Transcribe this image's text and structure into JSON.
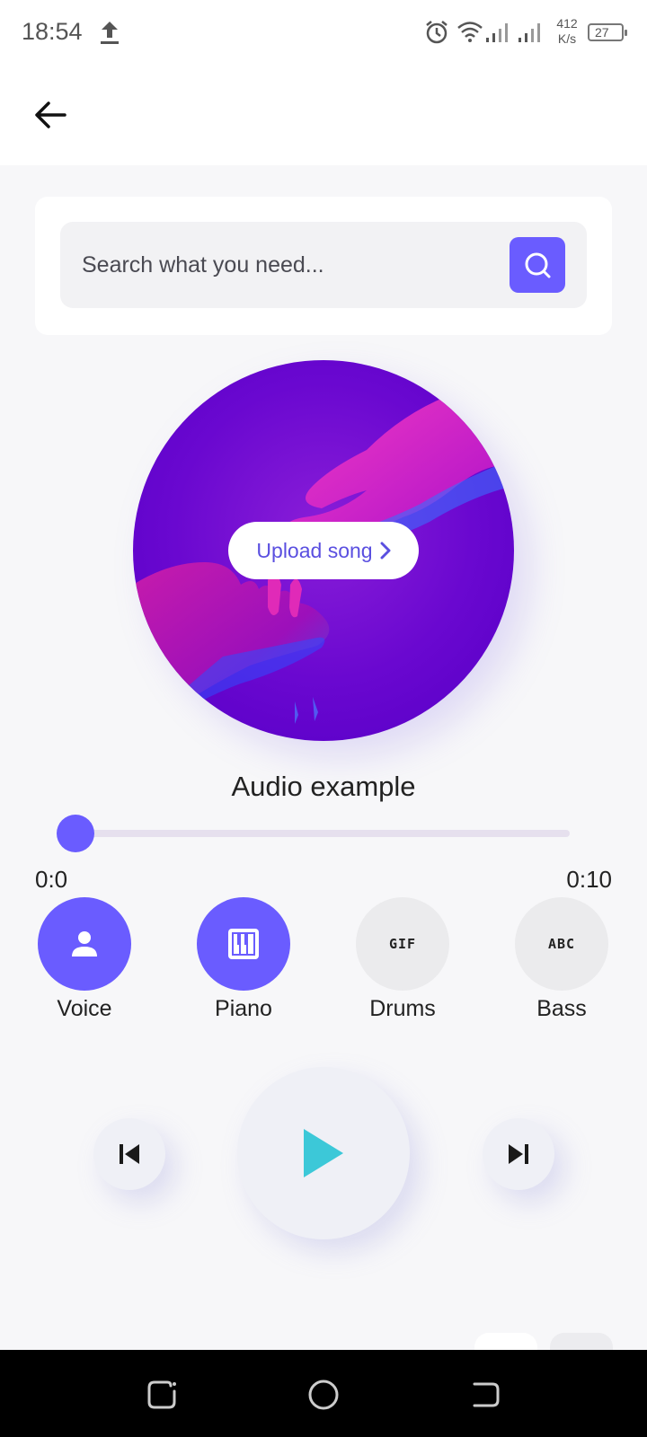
{
  "status_bar": {
    "time": "18:54",
    "net_speed_value": "412",
    "net_speed_unit": "K/s",
    "battery": "27",
    "icons": [
      "upload-icon",
      "alarm-icon",
      "wifi-icon",
      "signal-icon",
      "signal-icon",
      "battery-icon"
    ]
  },
  "app_bar": {
    "back_icon": "arrow-left-icon"
  },
  "search": {
    "placeholder": "Search what you need...",
    "button_icon": "search-icon",
    "accent": "#6a5cff"
  },
  "player": {
    "artwork": "hands-neon-purple-artwork",
    "upload_label": "Upload song",
    "upload_icon": "chevron-right-icon",
    "title": "Audio example",
    "position": "0:0",
    "duration": "0:10",
    "progress": 0.0,
    "instruments": [
      {
        "label": "Voice",
        "icon": "person-icon",
        "active": true
      },
      {
        "label": "Piano",
        "icon": "piano-icon",
        "active": true
      },
      {
        "label": "Drums",
        "icon": "gif-icon",
        "glyph": "GIF",
        "active": false
      },
      {
        "label": "Bass",
        "icon": "abc-icon",
        "glyph": "ABC",
        "active": false
      }
    ],
    "controls": {
      "prev_icon": "skip-previous-icon",
      "play_icon": "play-icon",
      "next_icon": "skip-next-icon",
      "play_color": "#3cc8d8"
    }
  },
  "nav_bar": {
    "icons": [
      "recents-icon",
      "home-icon",
      "back-icon"
    ]
  }
}
